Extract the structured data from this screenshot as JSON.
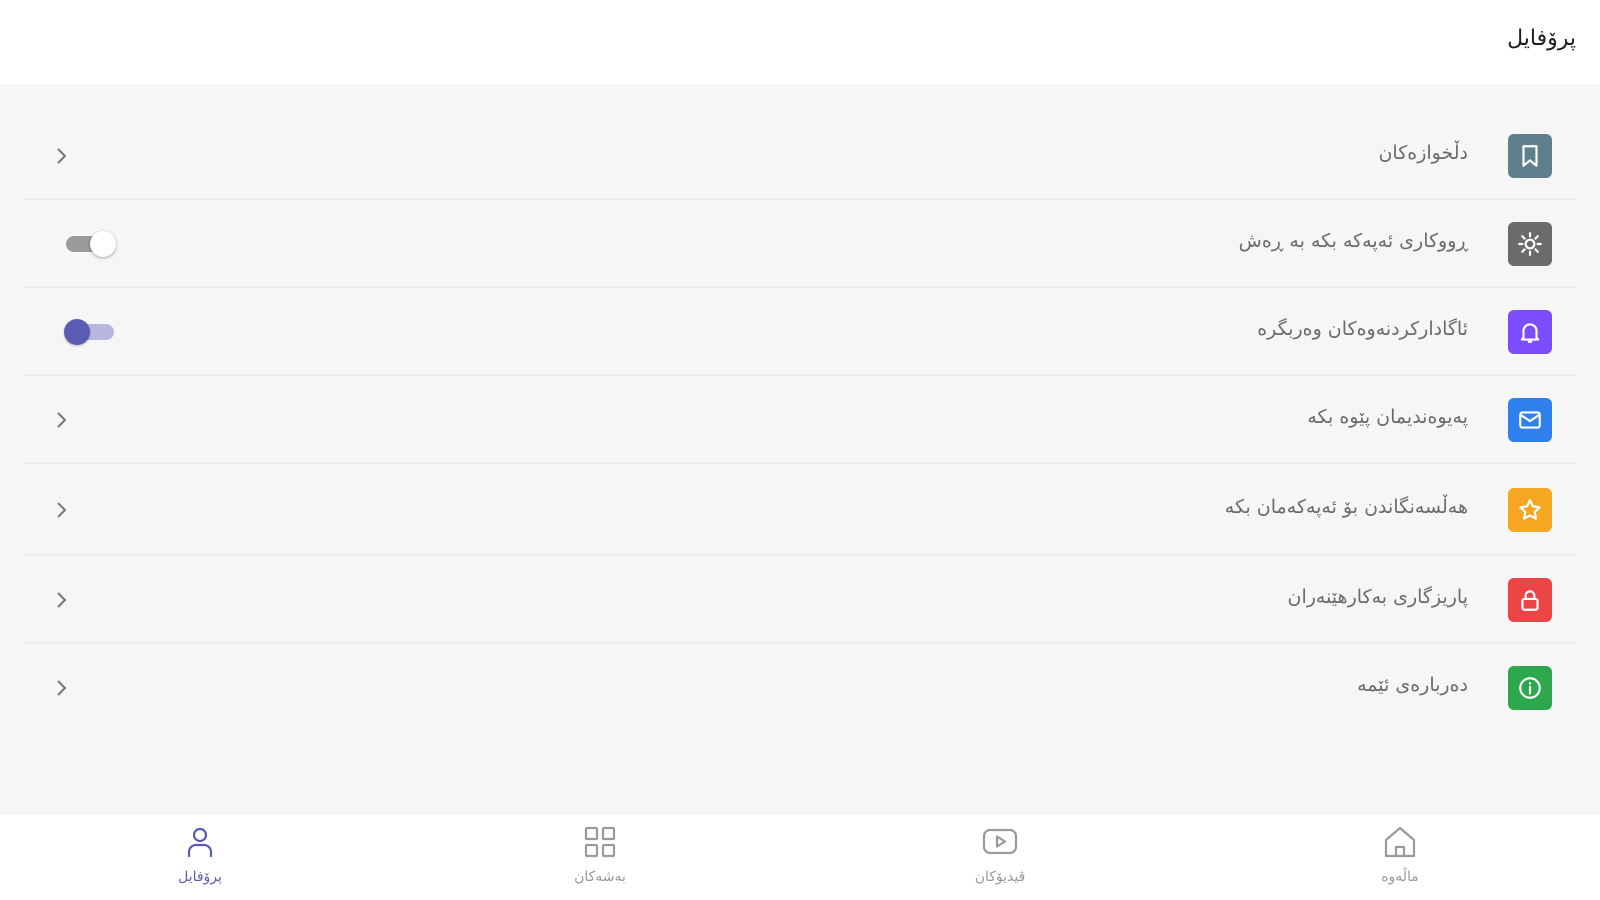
{
  "header": {
    "title": "پرۆفایل"
  },
  "settings": [
    {
      "label": "دڵخوازەکان",
      "icon": "bookmark-icon",
      "color": "#5f7f8c",
      "control": "chevron"
    },
    {
      "label": "ڕووکاری ئەپەکە بکە بە ڕەش",
      "icon": "sun-icon",
      "color": "#6b6b6b",
      "control": "switch",
      "toggle_on": false
    },
    {
      "label": "ئاگادارکردنەوەکان وەربگرە",
      "icon": "bell-icon",
      "color": "#7c4dff",
      "control": "switch",
      "toggle_on": true
    },
    {
      "label": "پەیوەندیمان پێوە بکە",
      "icon": "mail-icon",
      "color": "#2f80ed",
      "control": "chevron"
    },
    {
      "label": "هەڵسەنگاندن بۆ ئەپەکەمان بکە",
      "icon": "star-icon",
      "color": "#f5a623",
      "control": "chevron"
    },
    {
      "label": "پاریزگاری بەکارهێنەران",
      "icon": "lock-icon",
      "color": "#eb4545",
      "control": "chevron"
    },
    {
      "label": "دەربارەی ئێمە",
      "icon": "info-icon",
      "color": "#2ea84f",
      "control": "chevron"
    }
  ],
  "bottom_nav": [
    {
      "label": "پرۆفایل",
      "icon": "person-icon",
      "active": true
    },
    {
      "label": "بەشەکان",
      "icon": "grid-icon",
      "active": false
    },
    {
      "label": "ڤیدیۆکان",
      "icon": "video-play-icon",
      "active": false
    },
    {
      "label": "ماڵەوە",
      "icon": "home-icon",
      "active": false
    }
  ],
  "colors": {
    "accent": "#5a5cb3",
    "inactive_nav": "#9a9a9a"
  }
}
